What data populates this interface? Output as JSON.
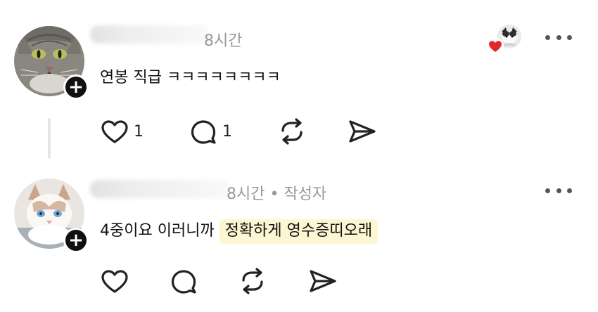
{
  "posts": [
    {
      "time": "8시간",
      "author_tag": "",
      "text": "연봉 직급 ㅋㅋㅋㅋㅋㅋㅋㅋ",
      "text_highlight": "",
      "likes": "1",
      "replies": "1",
      "liked_by_icon": "cat-avatar-icon",
      "avatar_icon": "tabby-cat-avatar"
    },
    {
      "time": "8시간 • 작성자",
      "text": "4중이요 이러니까 ",
      "text_highlight": "정확하게 영수증띠오래",
      "likes": "",
      "replies": "",
      "avatar_icon": "ragdoll-cat-avatar"
    }
  ],
  "colors": {
    "heart": "#e0282e",
    "highlight": "#fdf6d2",
    "meta": "#999999"
  }
}
